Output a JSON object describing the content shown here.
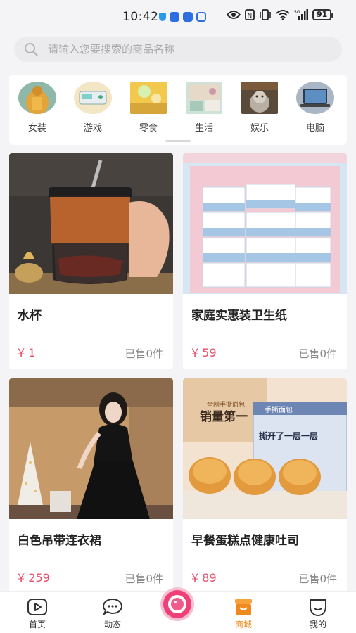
{
  "status_bar": {
    "time": "10:42",
    "battery": "91",
    "network_label": "5G"
  },
  "search": {
    "placeholder": "请输入您要搜索的商品名称"
  },
  "categories": [
    {
      "label": "女装",
      "icon": "women-clothing-thumb"
    },
    {
      "label": "游戏",
      "icon": "game-thumb"
    },
    {
      "label": "零食",
      "icon": "snack-thumb"
    },
    {
      "label": "生活",
      "icon": "life-thumb"
    },
    {
      "label": "娱乐",
      "icon": "entertainment-thumb"
    },
    {
      "label": "电脑",
      "icon": "computer-thumb"
    }
  ],
  "products": [
    {
      "title": "水杯",
      "price": "¥ 1",
      "sold": "已售0件"
    },
    {
      "title": "家庭实惠装卫生纸",
      "price": "¥ 59",
      "sold": "已售0件"
    },
    {
      "title": "白色吊带连衣裙",
      "price": "¥ 259",
      "sold": "已售0件"
    },
    {
      "title": "早餐蛋糕点健康吐司",
      "price": "¥ 89",
      "sold": "已售0件"
    }
  ],
  "product_image_text": {
    "bread_promo_top": "全网手撕面包",
    "bread_promo_main": "销量第一",
    "bread_box_label": "手撕面包",
    "bread_slogan": "撕开了一层一层"
  },
  "bottom_nav": {
    "items": [
      {
        "label": "首页",
        "icon": "home-icon",
        "active": false
      },
      {
        "label": "动态",
        "icon": "chat-bubble-icon",
        "active": false
      },
      {
        "label": "商城",
        "icon": "shop-icon",
        "active": true
      },
      {
        "label": "我的",
        "icon": "profile-icon",
        "active": false
      }
    ]
  },
  "colors": {
    "price": "#e8506c",
    "active_tab": "#f08a1e",
    "center_button": "#f0407a"
  }
}
